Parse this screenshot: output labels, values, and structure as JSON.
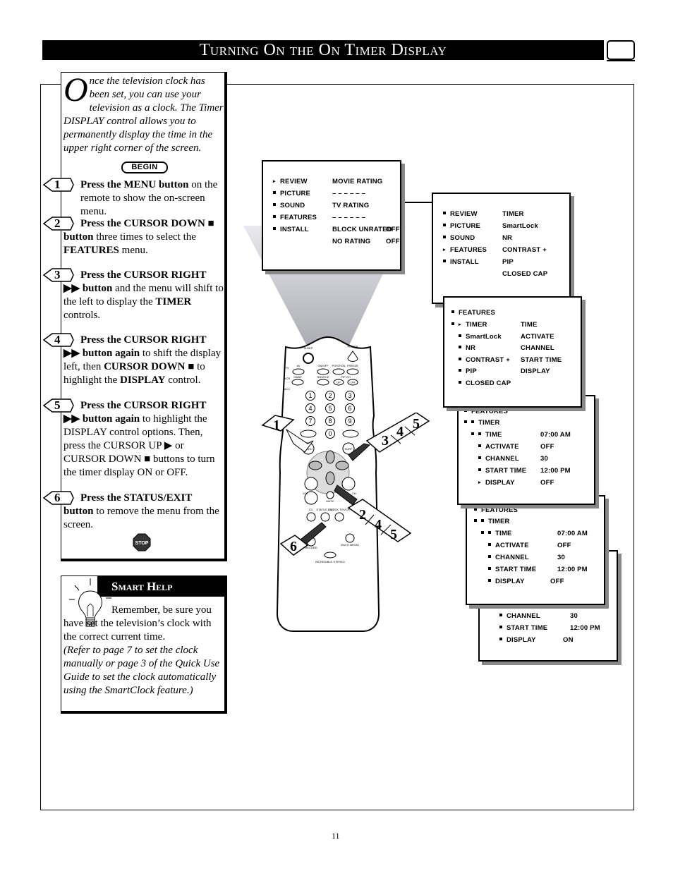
{
  "page": {
    "title": "Turning On the On Timer Display",
    "page_number": "11",
    "icon": "tv-screen-icon"
  },
  "intro": {
    "drop_cap": "O",
    "text": "nce the television clock has been set, you can use your television as a clock. The Timer DISPLAY control allows you to permanently display the time in the upper right corner of the screen.",
    "begin_label": "BEGIN"
  },
  "steps": [
    {
      "num": "1",
      "bold": "Press the MENU button",
      "rest": " on the remote to show the on-screen menu."
    },
    {
      "num": "2",
      "bold": "Press the CURSOR DOWN ■ button",
      "rest": " three times to select the ",
      "bold2": "FEATURES",
      "rest2": " menu."
    },
    {
      "num": "3",
      "bold": "Press the CURSOR RIGHT ▶▶ button",
      "rest": " and the menu will shift to the left to display the ",
      "bold2": "TIMER",
      "rest2": " controls."
    },
    {
      "num": "4",
      "bold": "Press the CURSOR RIGHT ▶▶ button again",
      "rest": " to shift the display left, then ",
      "bold2": "CURSOR DOWN ■",
      "rest2": " to highlight the ",
      "bold3": "DISPLAY",
      "rest3": " control."
    },
    {
      "num": "5",
      "bold": "Press the CURSOR RIGHT ▶▶ button again",
      "rest": " to highlight the DISPLAY control options. Then, press the CURSOR UP ▶ or CURSOR DOWN ■ buttons to turn the timer display ON or OFF."
    },
    {
      "num": "6",
      "bold": "Press the STATUS/EXIT button",
      "rest": " to remove the menu from the screen."
    }
  ],
  "stop_label": "STOP",
  "smart_help": {
    "title": "Smart Help",
    "text_plain": "Remember, be sure you have set the television’s clock with the correct current time.",
    "text_italic": "(Refer to page 7 to set the clock manually or page 3 of the Quick Use Guide to set the clock automatically using the SmartClock feature.)"
  },
  "screens": {
    "main_menu": {
      "left": [
        "REVIEW",
        "PICTURE",
        "SOUND",
        "FEATURES",
        "INSTALL"
      ],
      "right": [
        "MOVIE RATING",
        "– – – – – –",
        "TV RATING",
        "– – – – – –",
        "BLOCK UNRATED",
        "NO RATING"
      ],
      "right_values": [
        "",
        "",
        "",
        "",
        "OFF",
        "OFF"
      ],
      "highlight": "REVIEW"
    },
    "features_menu": {
      "left": [
        "REVIEW",
        "PICTURE",
        "SOUND",
        "FEATURES",
        "INSTALL"
      ],
      "right": [
        "TIMER",
        "SmartLock",
        "NR",
        "CONTRAST +",
        "PIP",
        "CLOSED CAP"
      ],
      "highlight": "FEATURES"
    },
    "timer_menu": {
      "header": "FEATURES",
      "left": [
        "TIMER",
        "SmartLock",
        "NR",
        "CONTRAST +",
        "PIP",
        "CLOSED CAP"
      ],
      "right": [
        "TIME",
        "ACTIVATE",
        "CHANNEL",
        "START TIME",
        "DISPLAY"
      ],
      "highlight": "TIMER"
    },
    "display_menu": {
      "header": "FEATURES",
      "sub": "TIMER",
      "items": [
        {
          "label": "TIME",
          "value": "07:00 AM"
        },
        {
          "label": "ACTIVATE",
          "value": "OFF"
        },
        {
          "label": "CHANNEL",
          "value": "30"
        },
        {
          "label": "START TIME",
          "value": "12:00 PM"
        },
        {
          "label": "DISPLAY",
          "value": "OFF"
        }
      ],
      "highlight": "DISPLAY"
    },
    "display_off_menu": {
      "header": "FEATURES",
      "sub": "TIMER",
      "items": [
        {
          "label": "TIME",
          "value": "07:00 AM"
        },
        {
          "label": "ACTIVATE",
          "value": "OFF"
        },
        {
          "label": "CHANNEL",
          "value": "30"
        },
        {
          "label": "START TIME",
          "value": "12:00 PM"
        },
        {
          "label": "DISPLAY",
          "value": "OFF"
        }
      ],
      "highlight_value": "OFF"
    },
    "display_on_menu": {
      "items": [
        {
          "label": "CHANNEL",
          "value": "30"
        },
        {
          "label": "START TIME",
          "value": "12:00 PM"
        },
        {
          "label": "DISPLAY",
          "value": "ON"
        }
      ],
      "highlight_value": "ON"
    }
  },
  "remote": {
    "labels": {
      "sleep": "SLEEP",
      "power": "POWER",
      "tv": "TV",
      "vcr": "VCR",
      "acc": "ACC",
      "av": "AV",
      "onoff": "ON/OFF",
      "position": "POSITION",
      "freeze": "FREEZE",
      "swap": "SWAP",
      "source": "SOURCE",
      "pipch": "PIP CH",
      "up": "UP",
      "dn": "DN",
      "smart_sound": "SMART SOUND",
      "smart_picture": "SMART PICTURE",
      "menu": "MENU",
      "surf": "SURF",
      "vol": "VOL",
      "ch": "CH",
      "mute": "MUTE",
      "cc": "CC",
      "status_exit": "STATUS EXIT",
      "clock_tvvcr": "CLOCK TV/VCR",
      "record": "RECORD",
      "multi_media": "MULTI MEDIA",
      "incredible_stereo": "INCREDIBLE STEREO"
    },
    "digits": [
      "1",
      "2",
      "3",
      "4",
      "5",
      "6",
      "7",
      "8",
      "9",
      "0"
    ],
    "callouts": {
      "left": [
        "1"
      ],
      "upper_right": [
        "3",
        "4",
        "5"
      ],
      "lower_right": [
        "2",
        "4",
        "5"
      ],
      "lower_left": [
        "6"
      ]
    }
  }
}
